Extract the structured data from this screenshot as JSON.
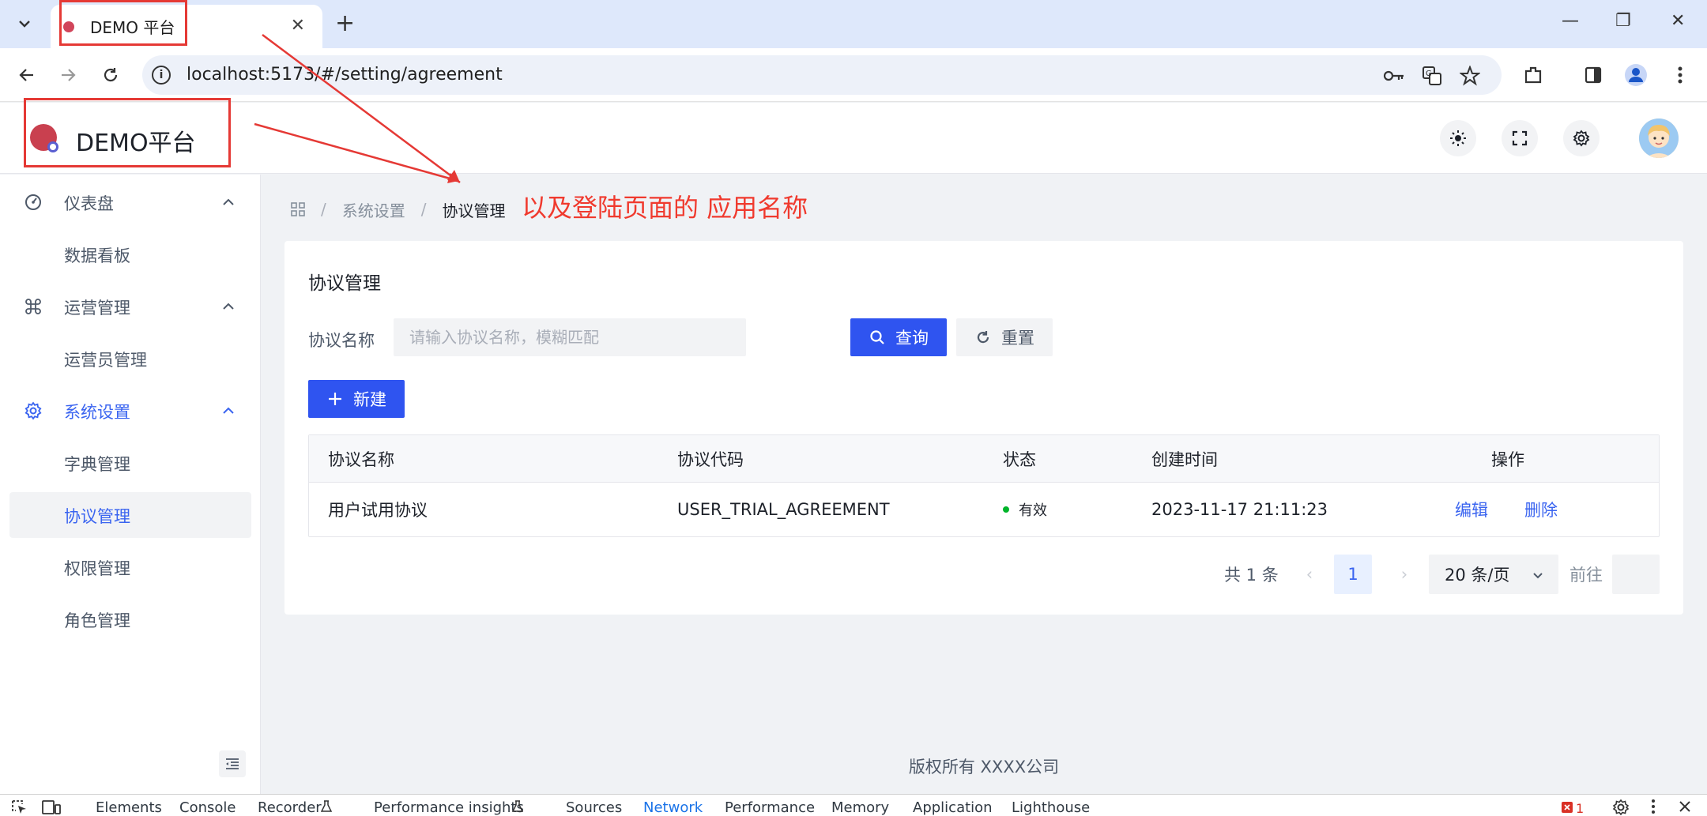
{
  "browser": {
    "tab_title": "DEMO 平台",
    "close_glyph": "✕",
    "new_tab_glyph": "+",
    "window_controls": {
      "minimize": "—",
      "restore": "❐",
      "close": "✕"
    },
    "info_glyph": "i",
    "url": "localhost:5173/#/setting/agreement"
  },
  "app": {
    "title": "DEMO平台",
    "accent_color": "#2f54f0"
  },
  "sidebar": {
    "groups": [
      {
        "label": "仪表盘",
        "icon": "dashboard-icon",
        "expanded": true,
        "items": [
          {
            "label": "数据看板"
          }
        ]
      },
      {
        "label": "运营管理",
        "icon": "command-icon",
        "expanded": true,
        "items": [
          {
            "label": "运营员管理"
          }
        ]
      },
      {
        "label": "系统设置",
        "icon": "settings-icon",
        "expanded": true,
        "active": true,
        "items": [
          {
            "label": "字典管理"
          },
          {
            "label": "协议管理",
            "active": true
          },
          {
            "label": "权限管理"
          },
          {
            "label": "角色管理"
          }
        ]
      }
    ]
  },
  "breadcrumb": {
    "sep": "/",
    "items": [
      "系统设置",
      "协议管理"
    ]
  },
  "annotation": {
    "text": "以及登陆页面的 应用名称",
    "color": "#f03a2e"
  },
  "page": {
    "title": "协议管理",
    "filter": {
      "label": "协议名称",
      "placeholder": "请输入协议名称，模糊匹配",
      "value": ""
    },
    "buttons": {
      "search": "查询",
      "reset": "重置",
      "create": "新建"
    },
    "table": {
      "columns": [
        "协议名称",
        "协议代码",
        "状态",
        "创建时间",
        "操作"
      ],
      "rows": [
        {
          "name": "用户试用协议",
          "code": "USER_TRIAL_AGREEMENT",
          "status": "有效",
          "created_at": "2023-11-17 21:11:23",
          "actions": [
            "编辑",
            "删除"
          ]
        }
      ]
    },
    "pagination": {
      "total": "共 1 条",
      "prev": "‹",
      "next": "›",
      "current_page": "1",
      "page_size": "20 条/页",
      "jump_label": "前往"
    }
  },
  "footer": {
    "text": "版权所有 XXXX公司"
  },
  "devtools": {
    "tabs": [
      "Elements",
      "Console",
      "Recorder",
      "Performance insights",
      "Sources",
      "Network",
      "Performance",
      "Memory",
      "Application",
      "Lighthouse"
    ],
    "active_tab": "Network",
    "error_count": "1"
  }
}
